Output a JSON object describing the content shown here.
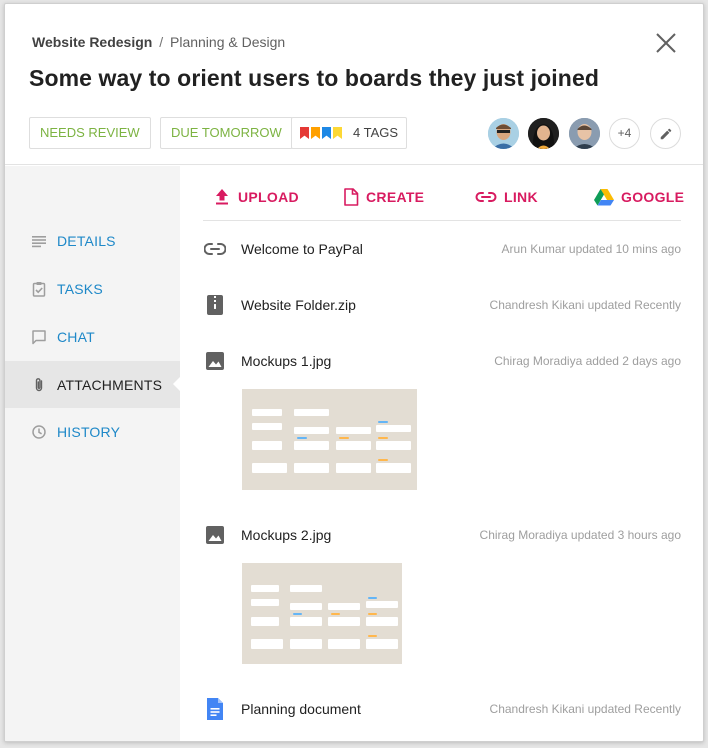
{
  "breadcrumb": {
    "project": "Website Redesign",
    "separator": "/",
    "section": "Planning & Design"
  },
  "title": "Some way to orient users to boards they just joined",
  "chips": {
    "review": "NEEDS REVIEW",
    "due": "DUE TOMORROW",
    "tags": "4 TAGS"
  },
  "tag_colors": [
    "#e53935",
    "#ffa000",
    "#1e88e5",
    "#fdd835"
  ],
  "members": {
    "more": "+4"
  },
  "sidebar": {
    "items": [
      {
        "label": "DETAILS",
        "icon": "details-icon"
      },
      {
        "label": "TASKS",
        "icon": "tasks-icon"
      },
      {
        "label": "CHAT",
        "icon": "chat-icon"
      },
      {
        "label": "ATTACHMENTS",
        "icon": "attachment-icon",
        "active": true
      },
      {
        "label": "HISTORY",
        "icon": "history-icon"
      }
    ]
  },
  "actions": {
    "upload": "UPLOAD",
    "create": "CREATE",
    "link": "LINK",
    "google": "GOOGLE"
  },
  "files": [
    {
      "name": "Welcome to PayPal",
      "meta": "Arun Kumar updated 10 mins ago",
      "icon": "link-icon"
    },
    {
      "name": "Website Folder.zip",
      "meta": "Chandresh Kikani updated Recently",
      "icon": "zip-icon"
    },
    {
      "name": "Mockups 1.jpg",
      "meta": "Chirag Moradiya added 2 days ago",
      "icon": "image-icon"
    },
    {
      "name": "Mockups 2.jpg",
      "meta": "Chirag Moradiya updated 3 hours ago",
      "icon": "image-icon"
    },
    {
      "name": "Planning document",
      "meta": "Chandresh Kikani updated Recently",
      "icon": "google-doc-icon"
    }
  ],
  "colors": {
    "accent": "#d81b60",
    "link": "#1e88c8",
    "tag_green": "#7cb342"
  }
}
